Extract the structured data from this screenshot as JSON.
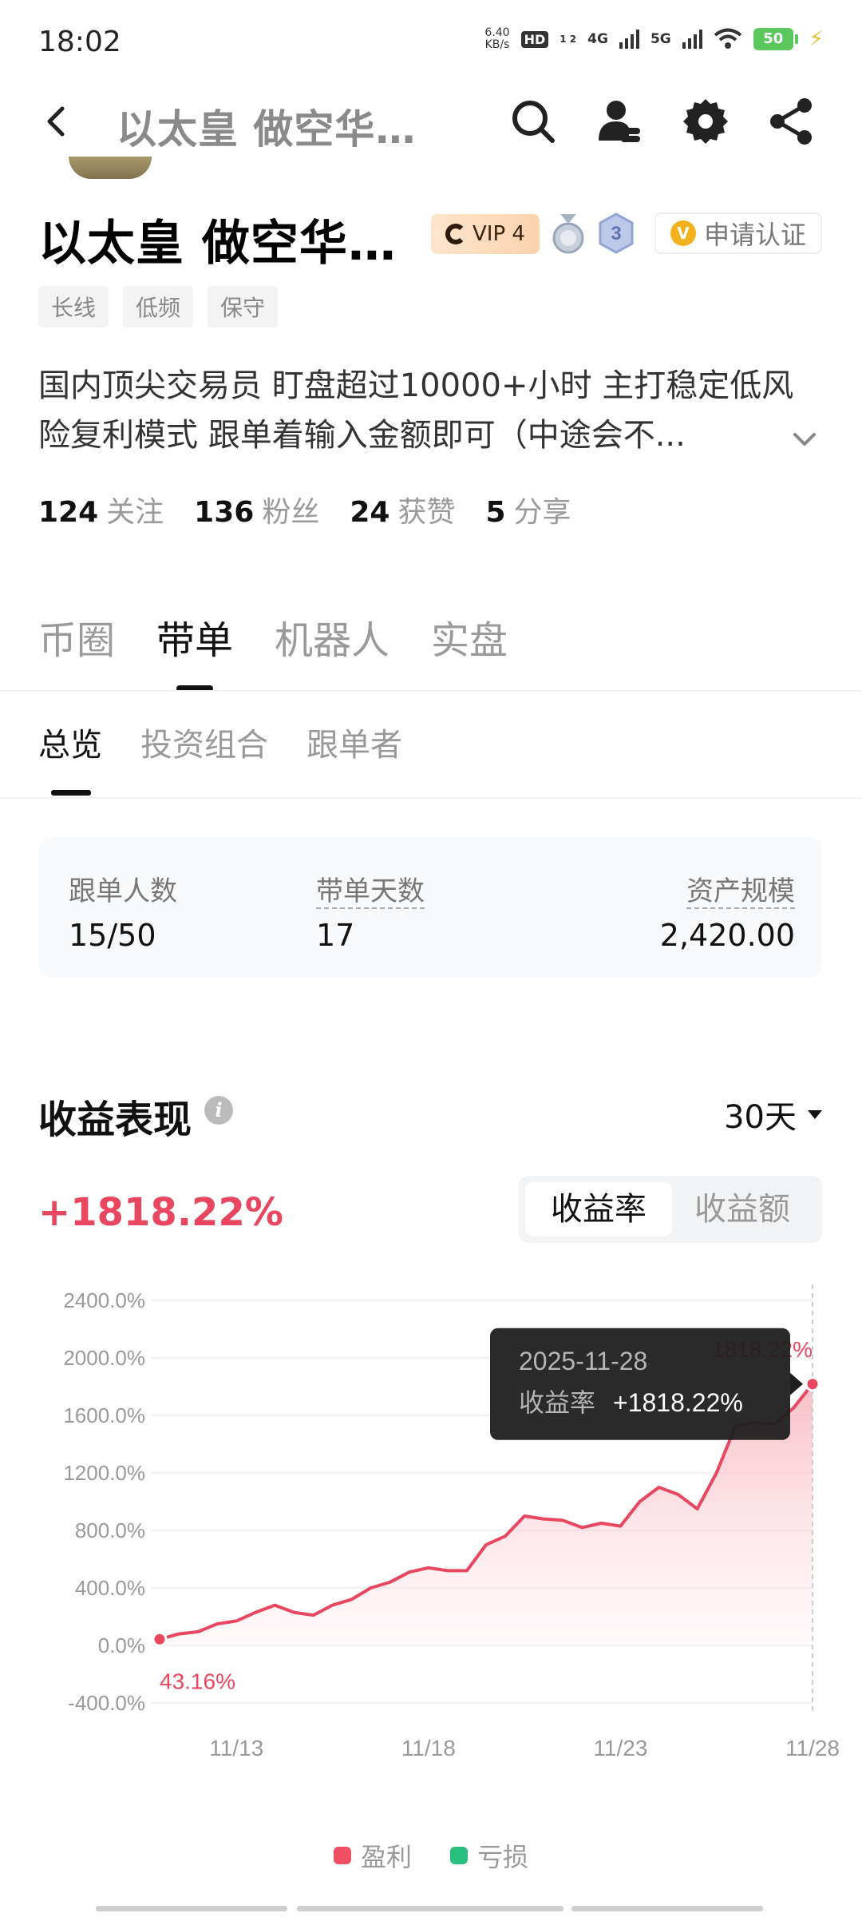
{
  "status_bar": {
    "time": "18:02",
    "net_speed_value": "6.40",
    "net_speed_unit": "KB/s",
    "hd_label": "HD",
    "hd_sub": "1 2",
    "net1": "4G",
    "net2": "5G",
    "battery": "50"
  },
  "header": {
    "title": "以太皇 做空华…",
    "icons": [
      "back-icon",
      "search-icon",
      "user-icon",
      "gear-icon",
      "share-icon"
    ]
  },
  "profile": {
    "name": "以太皇 做空华…",
    "vip_label": "VIP 4",
    "level": "3",
    "verify_mark": "V",
    "verify_label": "申请认证",
    "tags": [
      "长线",
      "低频",
      "保守"
    ],
    "bio_line1": "国内顶尖交易员 盯盘超过10000+小时 主打稳定低风",
    "bio_line2": "险复利模式 跟单着输入金额即可（中途会不...",
    "stats": [
      {
        "num": "124",
        "label": "关注"
      },
      {
        "num": "136",
        "label": "粉丝"
      },
      {
        "num": "24",
        "label": "获赞"
      },
      {
        "num": "5",
        "label": "分享"
      }
    ]
  },
  "main_tabs": [
    "币圈",
    "带单",
    "机器人",
    "实盘"
  ],
  "main_tab_active": "带单",
  "sub_tabs": [
    "总览",
    "投资组合",
    "跟单者"
  ],
  "sub_tab_active": "总览",
  "summary": {
    "followers_label": "跟单人数",
    "followers_value": "15/50",
    "days_label": "带单天数",
    "days_value": "17",
    "aum_label": "资产规模",
    "aum_value": "2,420.00"
  },
  "performance": {
    "title": "收益表现",
    "info_icon": "i",
    "period": "30天",
    "total_return": "+1818.22%",
    "toggle": [
      "收益率",
      "收益额"
    ],
    "toggle_active": "收益率"
  },
  "chart_data": {
    "type": "area",
    "y_tick_labels": [
      "2400.0%",
      "2000.0%",
      "1600.0%",
      "1200.0%",
      "800.0%",
      "400.0%",
      "0.0%",
      "-400.0%"
    ],
    "y_ticks": [
      2400,
      2000,
      1600,
      1200,
      800,
      400,
      0,
      -400
    ],
    "ylim": [
      -400,
      2400
    ],
    "x_tick_labels": [
      "11/13",
      "11/18",
      "11/23",
      "11/28"
    ],
    "x_ticks": [
      13,
      18,
      23,
      28
    ],
    "xlim": [
      11,
      28
    ],
    "x": [
      11,
      11.5,
      12,
      12.5,
      13,
      13.5,
      14,
      14.5,
      15,
      15.5,
      16,
      16.5,
      17,
      17.5,
      18,
      18.5,
      19,
      19.5,
      20,
      20.5,
      21,
      21.5,
      22,
      22.5,
      23,
      23.5,
      24,
      24.5,
      25,
      25.5,
      26,
      26.5,
      27,
      27.5,
      28
    ],
    "values": [
      43,
      80,
      95,
      150,
      170,
      230,
      280,
      230,
      210,
      280,
      320,
      400,
      440,
      510,
      540,
      520,
      520,
      700,
      760,
      900,
      880,
      870,
      820,
      850,
      830,
      1000,
      1100,
      1050,
      950,
      1200,
      1530,
      1550,
      1540,
      1650,
      1818
    ],
    "start_label": "43.16%",
    "end_label": "1818.22%",
    "tooltip": {
      "date": "2025-11-28",
      "label": "收益率",
      "value": "+1818.22%"
    },
    "colors": {
      "line": "#e8475f",
      "fill": "#fbd3d9"
    },
    "legend": [
      {
        "name": "盈利",
        "color": "#f14f62"
      },
      {
        "name": "亏损",
        "color": "#2bbf7f"
      }
    ]
  }
}
